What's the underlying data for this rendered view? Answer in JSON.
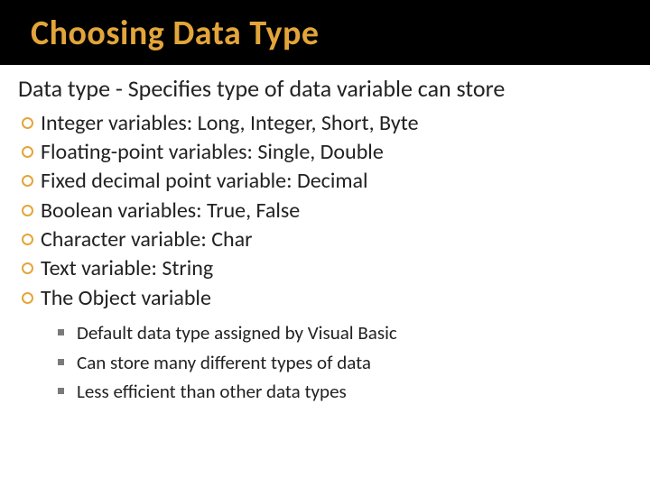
{
  "title": "Choosing Data Type",
  "lead": "Data type - Specifies type of data variable can store",
  "bullets": [
    "Integer variables: Long, Integer, Short, Byte",
    "Floating-point variables: Single, Double",
    "Fixed decimal point variable: Decimal",
    "Boolean variables: True, False",
    "Character variable: Char",
    "Text variable: String",
    "The Object variable"
  ],
  "subBullets": [
    "Default data type assigned by Visual Basic",
    "Can store many different types of data",
    "Less efficient than other data types"
  ]
}
